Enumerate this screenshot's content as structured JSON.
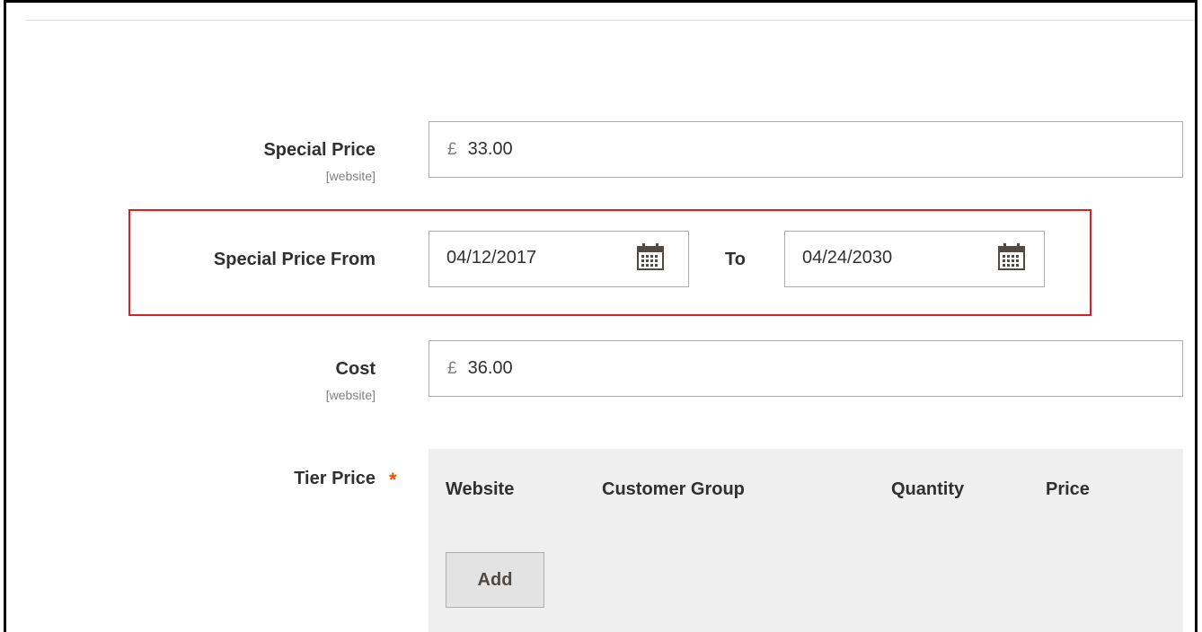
{
  "special_price": {
    "label": "Special Price",
    "scope": "[website]",
    "currency": "£",
    "value": "33.00"
  },
  "special_price_from": {
    "label": "Special Price From",
    "from_value": "04/12/2017",
    "to_label": "To",
    "to_value": "04/24/2030"
  },
  "cost": {
    "label": "Cost",
    "scope": "[website]",
    "currency": "£",
    "value": "36.00"
  },
  "tier_price": {
    "label": "Tier Price",
    "required_mark": "*",
    "columns": [
      "Website",
      "Customer Group",
      "Quantity",
      "Price"
    ],
    "add_label": "Add"
  },
  "colors": {
    "highlight_border": "#d4212b",
    "required": "#eb5202",
    "panel_background": "#efefef"
  },
  "icons": {
    "calendar": "calendar-icon"
  }
}
